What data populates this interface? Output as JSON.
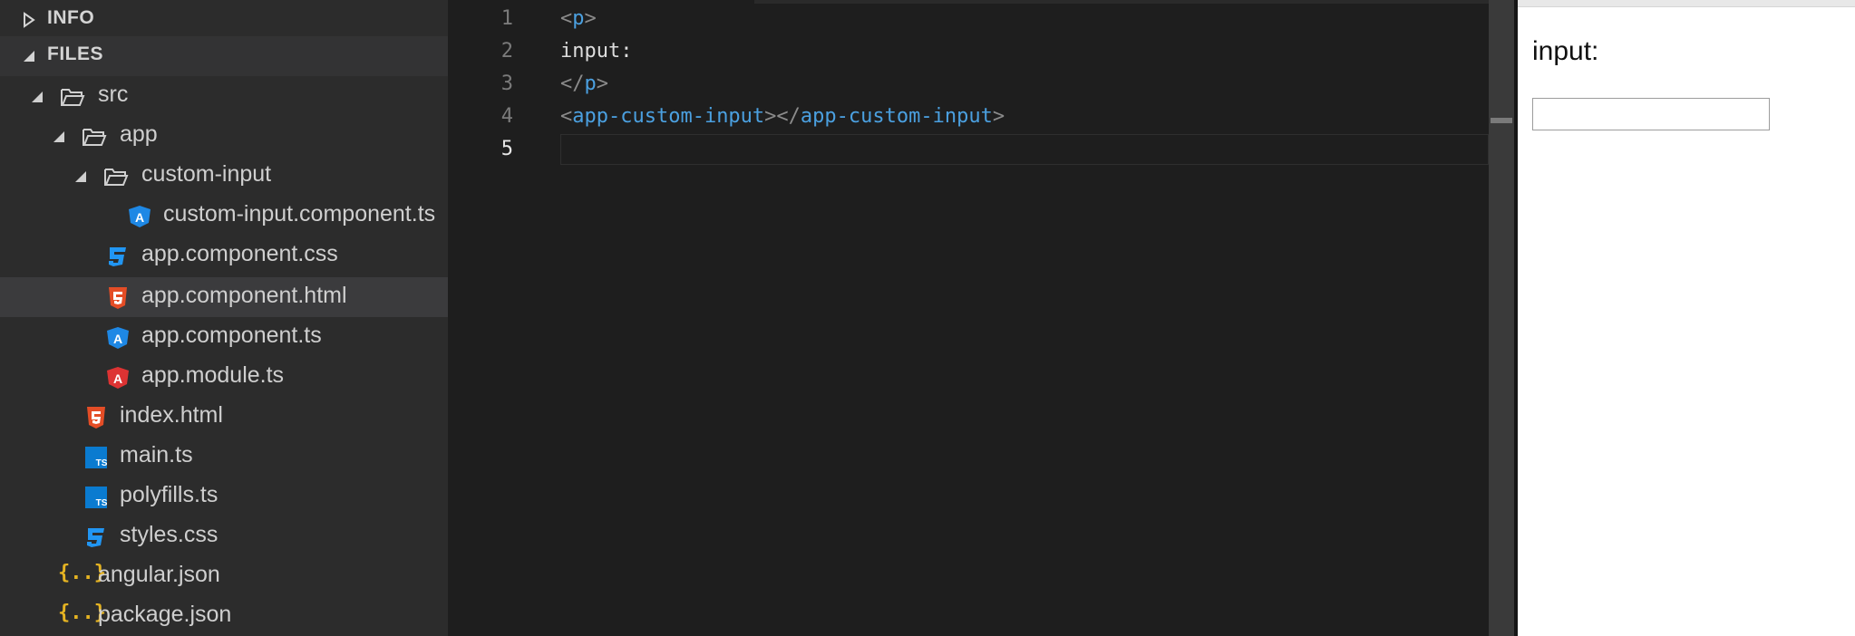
{
  "sidebar": {
    "sections": {
      "info": "INFO",
      "files": "FILES"
    },
    "tree": [
      {
        "label": "src",
        "icon": "folder-icon",
        "expanded": true
      },
      {
        "label": "app",
        "icon": "folder-icon",
        "expanded": true
      },
      {
        "label": "custom-input",
        "icon": "folder-icon",
        "expanded": true
      },
      {
        "label": "custom-input.component.ts",
        "icon": "angular-icon"
      },
      {
        "label": "app.component.css",
        "icon": "css3-icon"
      },
      {
        "label": "app.component.html",
        "icon": "html5-icon",
        "selected": true
      },
      {
        "label": "app.component.ts",
        "icon": "angular-icon"
      },
      {
        "label": "app.module.ts",
        "icon": "angular-red-icon"
      },
      {
        "label": "index.html",
        "icon": "html5-icon"
      },
      {
        "label": "main.ts",
        "icon": "typescript-icon"
      },
      {
        "label": "polyfills.ts",
        "icon": "typescript-icon"
      },
      {
        "label": "styles.css",
        "icon": "css3-icon"
      },
      {
        "label": "angular.json",
        "icon": "json-icon",
        "icon_text": "{..}"
      },
      {
        "label": "package.json",
        "icon": "json-icon",
        "icon_text": "{..}"
      }
    ]
  },
  "editor": {
    "line_numbers": [
      "1",
      "2",
      "3",
      "4",
      "5"
    ],
    "active_line": "5",
    "lines": {
      "l1": {
        "open": "<",
        "tag": "p",
        "close": ">"
      },
      "l2": {
        "text": "input:"
      },
      "l3": {
        "open": "</",
        "tag": "p",
        "close": ">"
      },
      "l4": {
        "open1": "<",
        "tag1": "app-custom-input",
        "mid": "></",
        "tag2": "app-custom-input",
        "close": ">"
      }
    }
  },
  "preview": {
    "text": "input:",
    "input_value": ""
  },
  "colors": {
    "sidebar_bg": "#2c2c2c",
    "editor_bg": "#1e1e1e",
    "tag": "#4ba0e0",
    "angular_blue": "#1e88e5",
    "angular_red": "#dd3333",
    "html5": "#e44d26",
    "css3": "#2196f3",
    "typescript": "#0a7bd0",
    "json": "#e6b422"
  }
}
